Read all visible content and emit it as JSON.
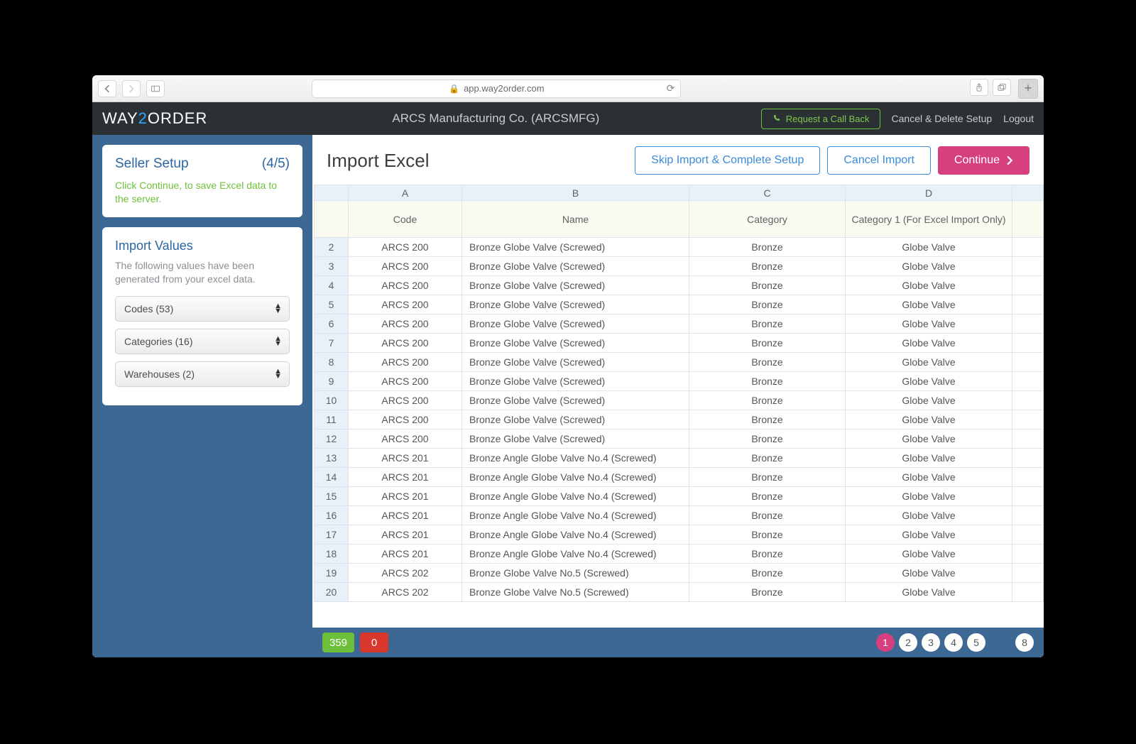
{
  "browser": {
    "url_host": "app.way2order.com"
  },
  "logo": {
    "pre": "WAY",
    "two": "2",
    "post": "ORDER"
  },
  "header": {
    "company": "ARCS Manufacturing Co. (ARCSMFG)",
    "call_back": "Request a Call Back",
    "cancel_delete": "Cancel & Delete Setup",
    "logout": "Logout"
  },
  "sidebar": {
    "seller_setup_title": "Seller Setup",
    "seller_setup_step": "(4/5)",
    "seller_setup_hint": "Click Continue, to save Excel data to the server.",
    "import_values_title": "Import Values",
    "import_values_desc": "The following values have been generated from your excel data.",
    "selects": {
      "codes": "Codes (53)",
      "categories": "Categories (16)",
      "warehouses": "Warehouses (2)"
    }
  },
  "main": {
    "title": "Import Excel",
    "skip": "Skip Import & Complete Setup",
    "cancel": "Cancel Import",
    "continue": "Continue"
  },
  "grid": {
    "col_letters": [
      "A",
      "B",
      "C",
      "D"
    ],
    "col_names": [
      "Code",
      "Name",
      "Category",
      "Category 1 (For Excel Import Only)"
    ],
    "rows": [
      {
        "n": "2",
        "code": "ARCS 200",
        "name": "Bronze Globe Valve (Screwed)",
        "cat": "Bronze",
        "cat1": "Globe Valve"
      },
      {
        "n": "3",
        "code": "ARCS 200",
        "name": "Bronze Globe Valve (Screwed)",
        "cat": "Bronze",
        "cat1": "Globe Valve"
      },
      {
        "n": "4",
        "code": "ARCS 200",
        "name": "Bronze Globe Valve (Screwed)",
        "cat": "Bronze",
        "cat1": "Globe Valve"
      },
      {
        "n": "5",
        "code": "ARCS 200",
        "name": "Bronze Globe Valve (Screwed)",
        "cat": "Bronze",
        "cat1": "Globe Valve"
      },
      {
        "n": "6",
        "code": "ARCS 200",
        "name": "Bronze Globe Valve (Screwed)",
        "cat": "Bronze",
        "cat1": "Globe Valve"
      },
      {
        "n": "7",
        "code": "ARCS 200",
        "name": "Bronze Globe Valve (Screwed)",
        "cat": "Bronze",
        "cat1": "Globe Valve"
      },
      {
        "n": "8",
        "code": "ARCS 200",
        "name": "Bronze Globe Valve (Screwed)",
        "cat": "Bronze",
        "cat1": "Globe Valve"
      },
      {
        "n": "9",
        "code": "ARCS 200",
        "name": "Bronze Globe Valve (Screwed)",
        "cat": "Bronze",
        "cat1": "Globe Valve"
      },
      {
        "n": "10",
        "code": "ARCS 200",
        "name": "Bronze Globe Valve (Screwed)",
        "cat": "Bronze",
        "cat1": "Globe Valve"
      },
      {
        "n": "11",
        "code": "ARCS 200",
        "name": "Bronze Globe Valve (Screwed)",
        "cat": "Bronze",
        "cat1": "Globe Valve"
      },
      {
        "n": "12",
        "code": "ARCS 200",
        "name": "Bronze Globe Valve (Screwed)",
        "cat": "Bronze",
        "cat1": "Globe Valve"
      },
      {
        "n": "13",
        "code": "ARCS 201",
        "name": "Bronze Angle Globe Valve No.4 (Screwed)",
        "cat": "Bronze",
        "cat1": "Globe Valve"
      },
      {
        "n": "14",
        "code": "ARCS 201",
        "name": "Bronze Angle Globe Valve No.4 (Screwed)",
        "cat": "Bronze",
        "cat1": "Globe Valve"
      },
      {
        "n": "15",
        "code": "ARCS 201",
        "name": "Bronze Angle Globe Valve No.4 (Screwed)",
        "cat": "Bronze",
        "cat1": "Globe Valve"
      },
      {
        "n": "16",
        "code": "ARCS 201",
        "name": "Bronze Angle Globe Valve No.4 (Screwed)",
        "cat": "Bronze",
        "cat1": "Globe Valve"
      },
      {
        "n": "17",
        "code": "ARCS 201",
        "name": "Bronze Angle Globe Valve No.4 (Screwed)",
        "cat": "Bronze",
        "cat1": "Globe Valve"
      },
      {
        "n": "18",
        "code": "ARCS 201",
        "name": "Bronze Angle Globe Valve No.4 (Screwed)",
        "cat": "Bronze",
        "cat1": "Globe Valve"
      },
      {
        "n": "19",
        "code": "ARCS 202",
        "name": "Bronze Globe Valve No.5 (Screwed)",
        "cat": "Bronze",
        "cat1": "Globe Valve"
      },
      {
        "n": "20",
        "code": "ARCS 202",
        "name": "Bronze Globe Valve No.5 (Screwed)",
        "cat": "Bronze",
        "cat1": "Globe Valve"
      }
    ]
  },
  "footer": {
    "green": "359",
    "red": "0",
    "pages": [
      "1",
      "2",
      "3",
      "4",
      "5"
    ],
    "last_page": "8",
    "active_page": "1"
  }
}
